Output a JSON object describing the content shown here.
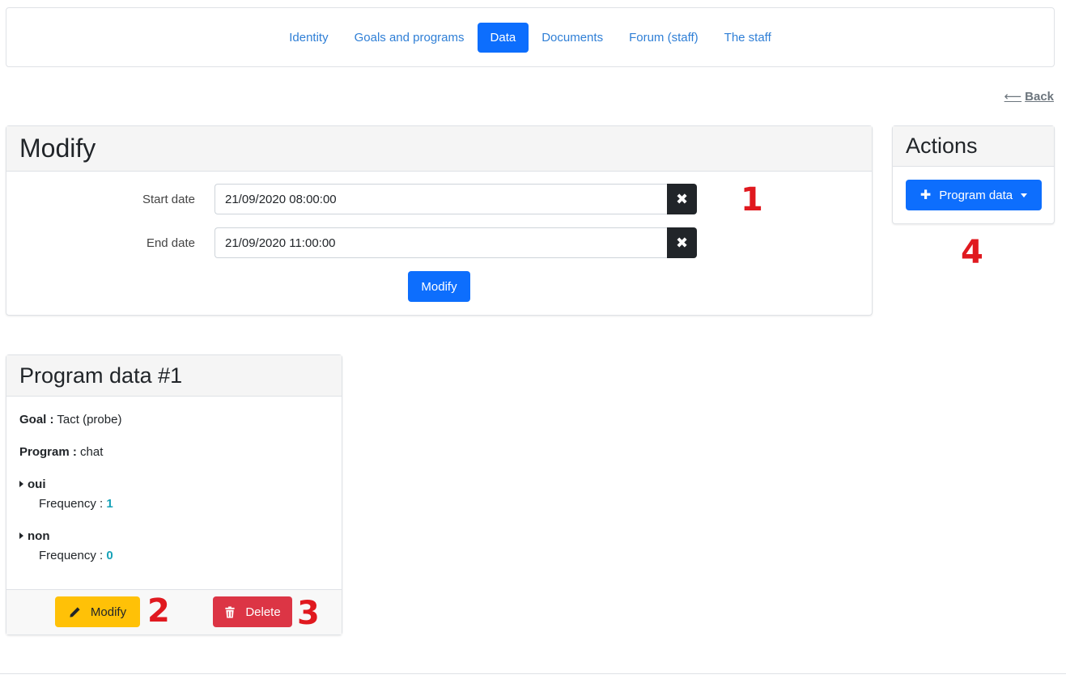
{
  "nav": {
    "items": [
      {
        "label": "Identity",
        "active": false
      },
      {
        "label": "Goals and programs",
        "active": false
      },
      {
        "label": "Data",
        "active": true
      },
      {
        "label": "Documents",
        "active": false
      },
      {
        "label": "Forum (staff)",
        "active": false
      },
      {
        "label": "The staff",
        "active": false
      }
    ]
  },
  "back": {
    "arrow": "⟵",
    "label": "Back"
  },
  "modify_card": {
    "title": "Modify",
    "start_label": "Start date",
    "start_value": "21/09/2020 08:00:00",
    "end_label": "End date",
    "end_value": "21/09/2020 11:00:00",
    "submit_label": "Modify",
    "clear_icon": "✖"
  },
  "actions_card": {
    "title": "Actions",
    "button_icon": "✚",
    "button_label": "Program data"
  },
  "program_card": {
    "title": "Program data #1",
    "goal_label": "Goal :",
    "goal_value": "Tact (probe)",
    "program_label": "Program :",
    "program_value": "chat",
    "answers": [
      {
        "name": "oui",
        "freq_label": "Frequency :",
        "freq_value": "1"
      },
      {
        "name": "non",
        "freq_label": "Frequency :",
        "freq_value": "0"
      }
    ],
    "modify_label": "Modify",
    "delete_label": "Delete"
  },
  "annotations": [
    "1",
    "2",
    "3",
    "4"
  ],
  "colors": {
    "primary": "#0d6efd",
    "warning": "#ffc107",
    "danger": "#dc3545",
    "annotation": "#e0191f",
    "frequency": "#17a2b8"
  }
}
